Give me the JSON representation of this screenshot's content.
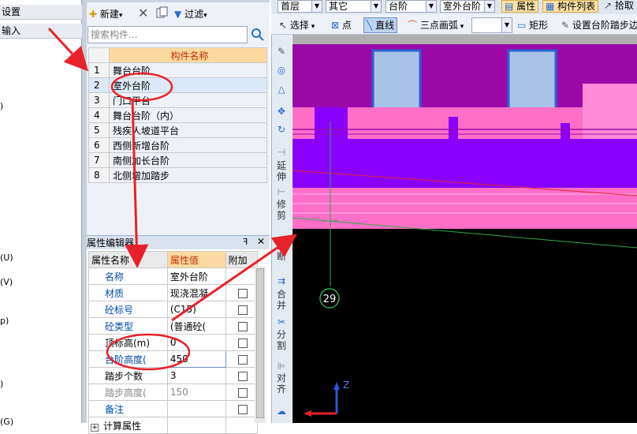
{
  "left_panel": {
    "menu_items": [
      "设置",
      "输入"
    ],
    "key_hints": [
      ")",
      "(U)",
      "(V)",
      "p)",
      ")",
      "(G)"
    ]
  },
  "component_list": {
    "toolbar": {
      "new_label": "新建",
      "filter_label": "过滤"
    },
    "search_placeholder": "搜索构件...",
    "column_header": "构件名称",
    "rows": [
      {
        "no": "1",
        "name": "舞台台阶"
      },
      {
        "no": "2",
        "name": "室外台阶"
      },
      {
        "no": "3",
        "name": "门口平台"
      },
      {
        "no": "4",
        "name": "舞台台阶（内）"
      },
      {
        "no": "5",
        "name": "残疾人坡道平台"
      },
      {
        "no": "6",
        "name": "西侧新增台阶"
      },
      {
        "no": "7",
        "name": "南侧加长台阶"
      },
      {
        "no": "8",
        "name": "北侧增加踏步"
      }
    ],
    "selected_index": 1
  },
  "property_editor": {
    "title": "属性编辑器",
    "pin": "ꟻ",
    "close": "✕",
    "headers": {
      "name": "属性名称",
      "value": "属性值",
      "extra": "附加"
    },
    "rows": [
      {
        "name": "名称",
        "value": "室外台阶",
        "checkbox": false,
        "style": "blue"
      },
      {
        "name": "材质",
        "value": "现浇混凝",
        "checkbox": true,
        "style": "blue"
      },
      {
        "name": "砼标号",
        "value": "(C15)",
        "checkbox": true,
        "style": "blue"
      },
      {
        "name": "砼类型",
        "value": "(普通砼(",
        "checkbox": true,
        "style": "blue"
      },
      {
        "name": "顶标高(m)",
        "value": "0",
        "checkbox": true,
        "style": "black"
      },
      {
        "name": "台阶高度(",
        "value": "450",
        "checkbox": true,
        "style": "blue"
      },
      {
        "name": "踏步个数",
        "value": "3",
        "checkbox": true,
        "style": "black"
      },
      {
        "name": "踏步高度(",
        "value": "150",
        "checkbox": true,
        "style": "grey"
      },
      {
        "name": "备注",
        "value": "",
        "checkbox": true,
        "style": "blue"
      }
    ],
    "expand_sign": "+",
    "more_row": "计算属性"
  },
  "top_toolbar": {
    "dropdowns": [
      "首层",
      "其它",
      "台阶",
      "室外台阶"
    ],
    "property_label": "属性",
    "component_list_label": "构件列表",
    "pick_label": "拾取",
    "select_label": "选择",
    "point_label": "点",
    "line_label": "直线",
    "arc_label": "三点画弧",
    "rect_label": "矩形",
    "set_step_label": "设置台阶踏步边"
  },
  "vertical_tools": [
    "延伸",
    "修剪",
    "打断",
    "合并",
    "分割",
    "对齐"
  ],
  "canvas": {
    "axis_number": "29",
    "axis_z_label": "Z"
  },
  "colors": {
    "magenta": "#9b0aa8",
    "purple": "#8a00ff",
    "pink": "#ff6ec7",
    "light_pink": "#ff8ad8",
    "steel_blue": "#a9c3e8",
    "annotation_red": "#e8222a",
    "axis_green": "#2fa84a"
  }
}
